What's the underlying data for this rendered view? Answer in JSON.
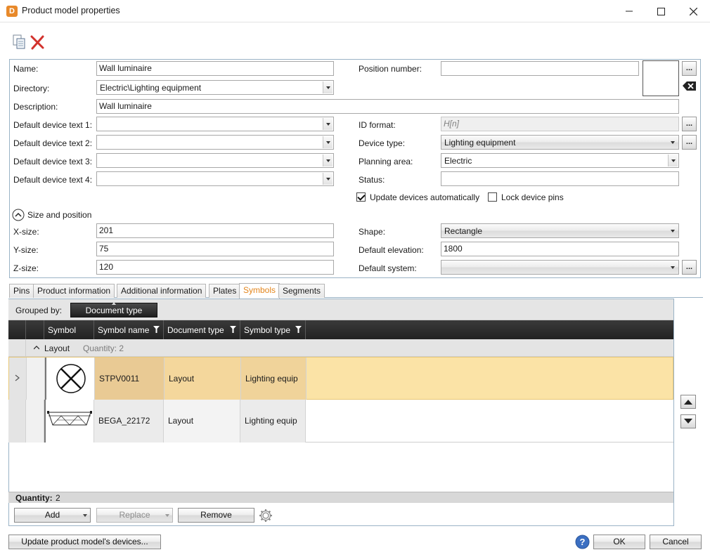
{
  "window": {
    "icon_letter": "D",
    "title": "Product model properties"
  },
  "form": {
    "name_label": "Name:",
    "name_value": "Wall luminaire",
    "directory_label": "Directory:",
    "directory_value": "Electric\\Lighting equipment",
    "description_label": "Description:",
    "description_value": "Wall luminaire",
    "ddt1_label": "Default device text 1:",
    "ddt2_label": "Default device text 2:",
    "ddt3_label": "Default device text 3:",
    "ddt4_label": "Default device text 4:",
    "position_label": "Position number:",
    "position_value": "",
    "id_format_label": "ID format:",
    "id_format_value": "H[n]",
    "device_type_label": "Device type:",
    "device_type_value": "Lighting equipment",
    "planning_area_label": "Planning area:",
    "planning_area_value": "Electric",
    "status_label": "Status:",
    "status_value": "",
    "update_devices_label": "Update devices automatically",
    "update_devices_checked": true,
    "lock_pins_label": "Lock device pins",
    "lock_pins_checked": false,
    "dots": "..."
  },
  "size_section": {
    "title": "Size and position",
    "x_label": "X-size:",
    "x_value": "201",
    "y_label": "Y-size:",
    "y_value": "75",
    "z_label": "Z-size:",
    "z_value": "120",
    "shape_label": "Shape:",
    "shape_value": "Rectangle",
    "elevation_label": "Default elevation:",
    "elevation_value": "1800",
    "system_label": "Default system:",
    "system_value": ""
  },
  "tabs": [
    {
      "label": "Pins"
    },
    {
      "label": "Product information"
    },
    {
      "label": "Additional information"
    },
    {
      "label": "Plates"
    },
    {
      "label": "Symbols",
      "active": true
    },
    {
      "label": "Segments"
    }
  ],
  "symbols": {
    "grouped_by_label": "Grouped by:",
    "group_chip": "Document type",
    "columns": [
      "Symbol",
      "Symbol name",
      "Document type",
      "Symbol type"
    ],
    "group_name": "Layout",
    "group_quantity": "Quantity: 2",
    "rows": [
      {
        "symbol_name": "STPV0011",
        "document_type": "Layout",
        "symbol_type": "Lighting equip",
        "selected": true
      },
      {
        "symbol_name": "BEGA_22172",
        "document_type": "Layout",
        "symbol_type": "Lighting equip",
        "selected": false
      }
    ],
    "footer_label": "Quantity:",
    "footer_value": "2",
    "add_label": "Add",
    "replace_label": "Replace",
    "remove_label": "Remove"
  },
  "bottom": {
    "update_button": "Update product model's devices...",
    "ok_button": "OK",
    "cancel_button": "Cancel"
  },
  "colors": {
    "accent_tab": "#e3861d",
    "selected_row": "#fbe3a6",
    "frame_border": "#9ab3c6"
  }
}
